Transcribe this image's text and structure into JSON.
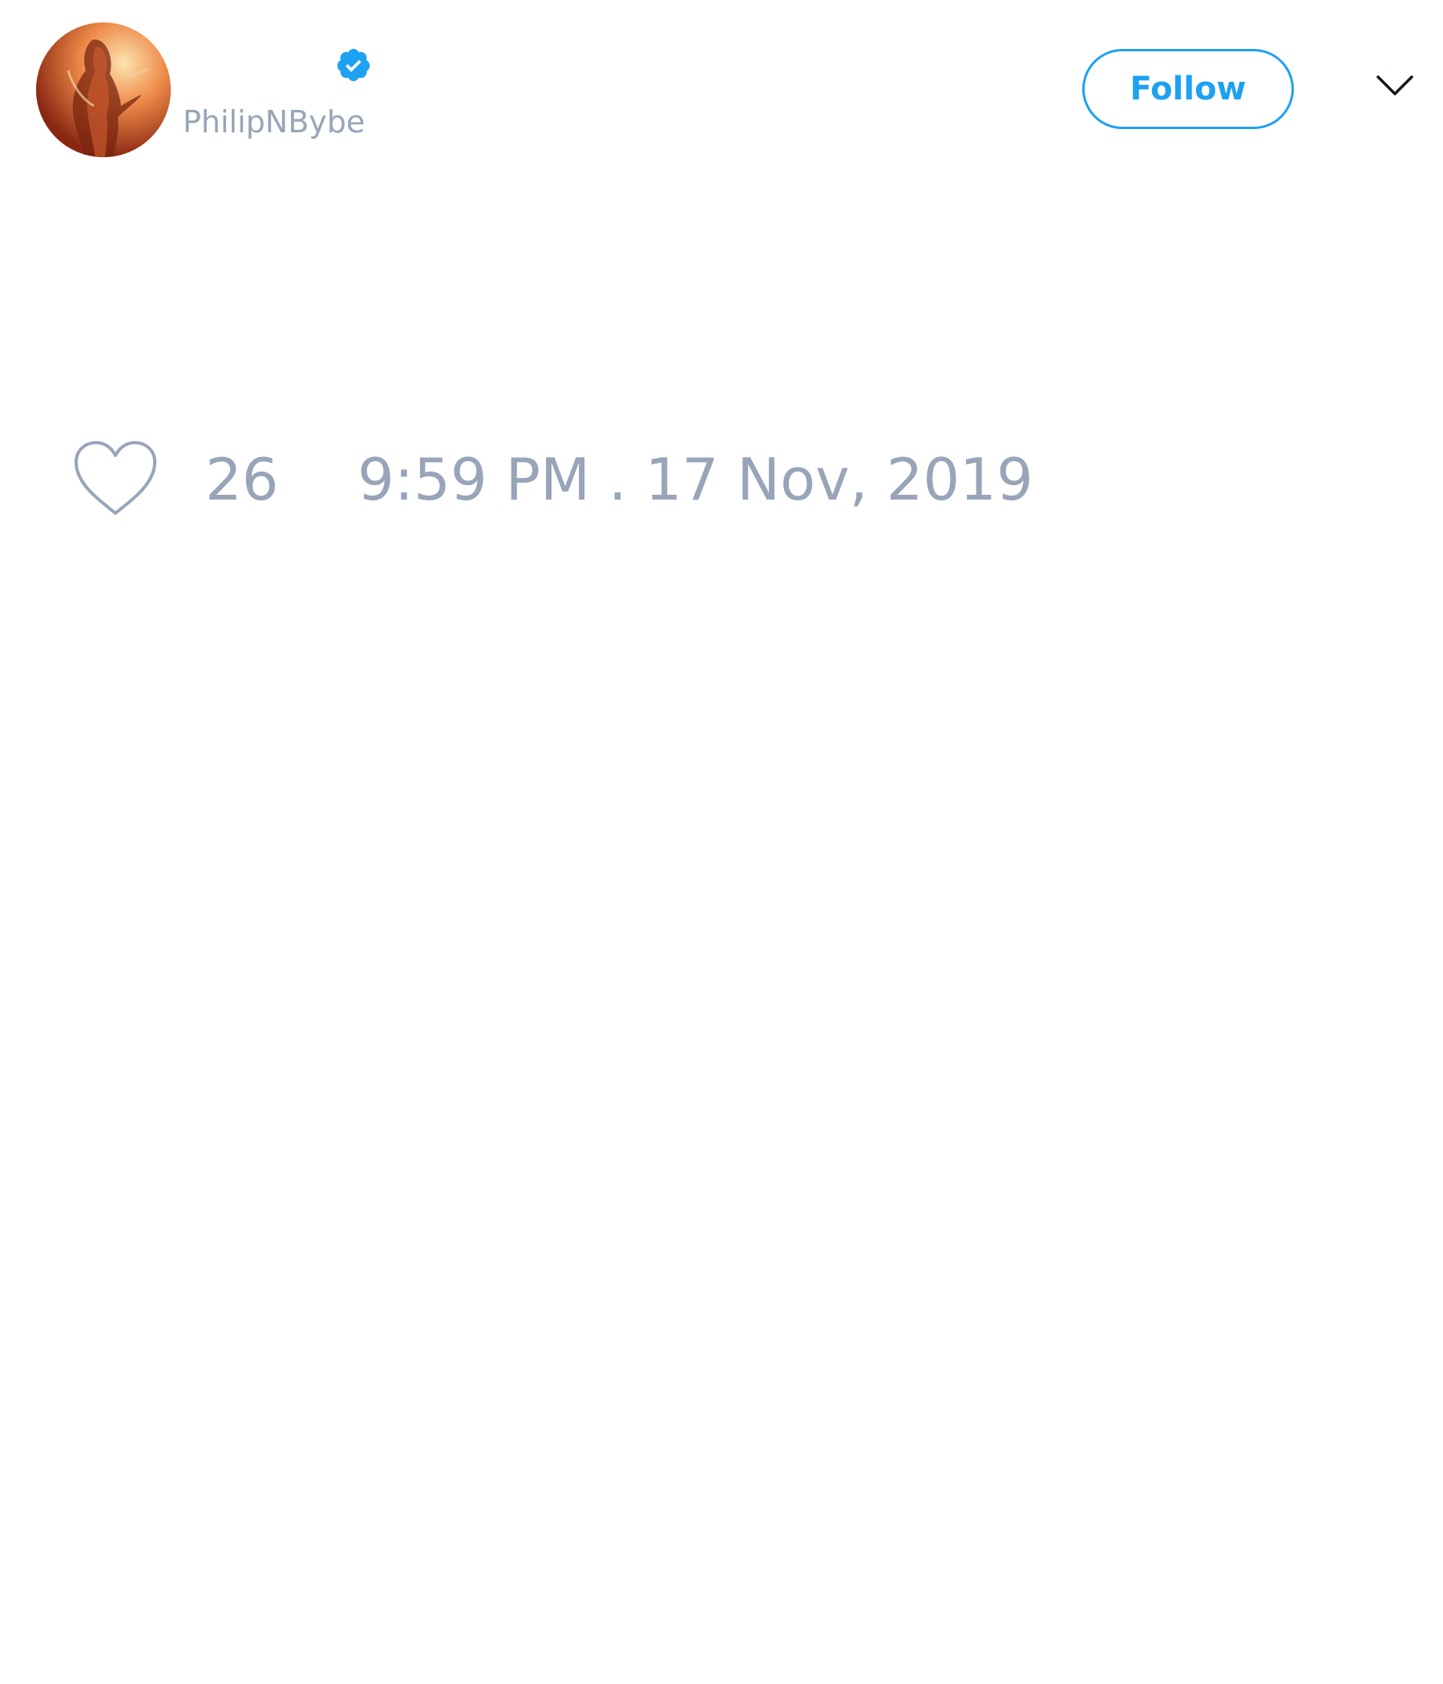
{
  "tweet": {
    "author": {
      "handle": "PhilipNBybe",
      "verified": true,
      "avatar_description_icon": "profile-photo"
    },
    "actions": {
      "follow_label": "Follow",
      "menu_icon": "chevron-down-icon"
    },
    "engagement": {
      "like_icon": "heart-outline-icon",
      "like_count": "26"
    },
    "timestamp": "9:59 PM . 17 Nov, 2019"
  },
  "colors": {
    "accent": "#1da1f2",
    "muted_text": "#98a5b8",
    "background": "#ffffff"
  }
}
